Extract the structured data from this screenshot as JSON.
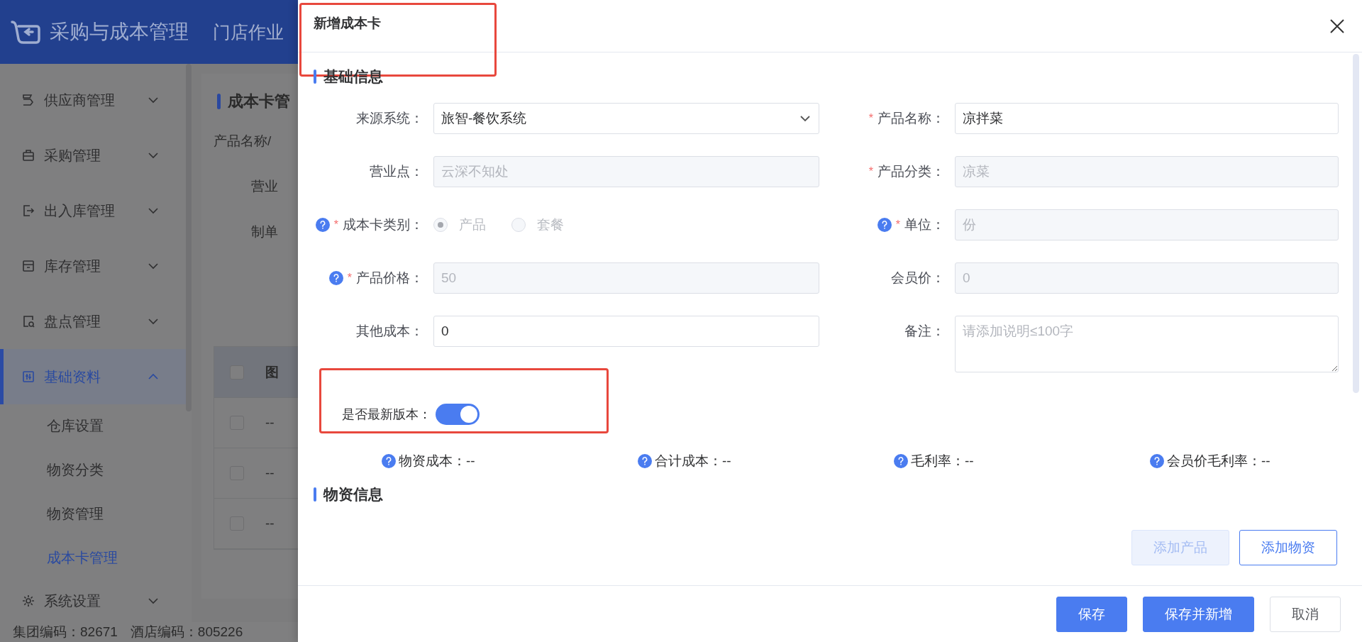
{
  "app": {
    "title": "采购与成本管理",
    "top_nav": [
      {
        "label": "门店作业"
      }
    ]
  },
  "sidebar": {
    "items": [
      {
        "label": "供应商管理",
        "expanded": false,
        "selected": false
      },
      {
        "label": "采购管理",
        "expanded": false,
        "selected": false
      },
      {
        "label": "出入库管理",
        "expanded": false,
        "selected": false
      },
      {
        "label": "库存管理",
        "expanded": false,
        "selected": false
      },
      {
        "label": "盘点管理",
        "expanded": false,
        "selected": false
      },
      {
        "label": "基础资料",
        "expanded": true,
        "selected": true,
        "children": [
          {
            "label": "仓库设置",
            "selected": false
          },
          {
            "label": "物资分类",
            "selected": false
          },
          {
            "label": "物资管理",
            "selected": false
          },
          {
            "label": "成本卡管理",
            "selected": true
          }
        ]
      },
      {
        "label": "系统设置",
        "expanded": false,
        "selected": false
      }
    ]
  },
  "footer": {
    "group_code": "集团编码：82671",
    "hotel_code": "酒店编码：805226"
  },
  "background_page": {
    "title": "成本卡管",
    "filters": [
      "产品名称/",
      "营业",
      "制单"
    ],
    "table": {
      "column_1": "图",
      "header_checked": false,
      "rows": [
        {
          "checked": false,
          "cell": "--"
        },
        {
          "checked": false,
          "cell": "--"
        },
        {
          "checked": false,
          "cell": "--"
        }
      ]
    }
  },
  "drawer": {
    "title": "新增成本卡",
    "title_highlighted": true,
    "sections": [
      {
        "title": "基础信息"
      },
      {
        "title": "物资信息"
      }
    ],
    "fields": [
      {
        "kind": "select",
        "label": "来源系统：",
        "help": false,
        "value": "旅智-餐饮系统",
        "disabled": false
      },
      {
        "kind": "input",
        "label": "产品名称：",
        "required_mark": "*",
        "help": false,
        "value": "凉拌菜",
        "disabled": false
      },
      {
        "kind": "input",
        "label": "营业点：",
        "help": false,
        "value": "云深不知处",
        "disabled": true
      },
      {
        "kind": "input",
        "label": "产品分类：",
        "required_mark": "*",
        "help": false,
        "value": "凉菜",
        "disabled": true
      },
      {
        "kind": "radio",
        "label": "成本卡类别：",
        "required_mark": "*",
        "help": true,
        "disabled": true,
        "options": [
          {
            "label": "产品",
            "selected": true
          },
          {
            "label": "套餐",
            "selected": false
          }
        ]
      },
      {
        "kind": "input",
        "label": "单位：",
        "required_mark": "*",
        "help": true,
        "value": "份",
        "disabled": true
      },
      {
        "kind": "input",
        "label": "产品价格：",
        "required_mark": "*",
        "help": true,
        "value": "50",
        "disabled": true
      },
      {
        "kind": "input",
        "label": "会员价：",
        "help": false,
        "value": "0",
        "disabled": true
      },
      {
        "kind": "input",
        "label": "其他成本：",
        "help": false,
        "value": "0",
        "disabled": false
      },
      {
        "kind": "textarea",
        "label": "备注：",
        "help": false,
        "placeholder": "请添加说明≤100字",
        "disabled": false
      }
    ],
    "latest_version": {
      "label": "是否最新版本：",
      "on": true,
      "highlighted": true
    },
    "stats": [
      {
        "label": "物资成本：--"
      },
      {
        "label": "合计成本：--"
      },
      {
        "label": "毛利率：--"
      },
      {
        "label": "会员价毛利率：--"
      }
    ],
    "material_buttons": [
      {
        "label": "添加产品",
        "disabled": true
      },
      {
        "label": "添加物资",
        "disabled": false
      }
    ],
    "footer_buttons": [
      {
        "label": "保存",
        "kind": "primary"
      },
      {
        "label": "保存并新增",
        "kind": "primary"
      },
      {
        "label": "取消",
        "kind": "default"
      }
    ]
  }
}
